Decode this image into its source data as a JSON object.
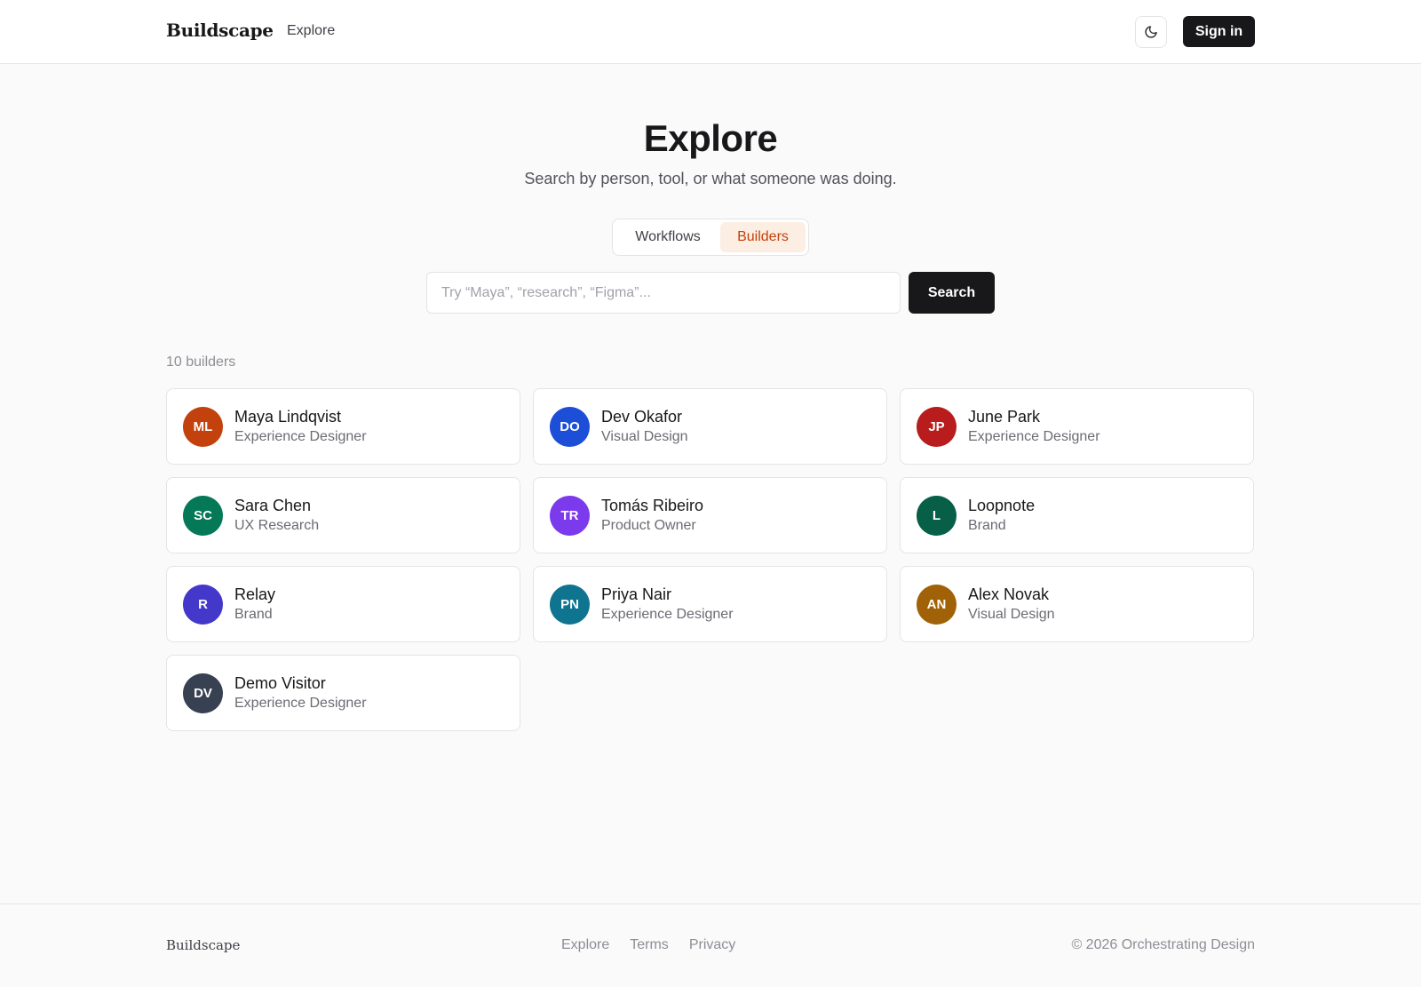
{
  "header": {
    "brand": "Buildscape",
    "nav_explore": "Explore",
    "theme_icon": "moon-icon",
    "signin_label": "Sign in"
  },
  "hero": {
    "title": "Explore",
    "subtitle": "Search by person, tool, or what someone was doing."
  },
  "toggle": {
    "options": [
      {
        "label": "Workflows",
        "selected": false
      },
      {
        "label": "Builders",
        "selected": true
      }
    ]
  },
  "search": {
    "value": "",
    "placeholder": "Try “Maya”, “research”, “Figma”...",
    "button_label": "Search"
  },
  "results": {
    "count_label": "10 builders",
    "builders": [
      {
        "initials": "ML",
        "name": "Maya Lindqvist",
        "role": "Experience Designer",
        "color": "#c2410c"
      },
      {
        "initials": "DO",
        "name": "Dev Okafor",
        "role": "Visual Design",
        "color": "#1d4ed8"
      },
      {
        "initials": "JP",
        "name": "June Park",
        "role": "Experience Designer",
        "color": "#b91c1c"
      },
      {
        "initials": "SC",
        "name": "Sara Chen",
        "role": "UX Research",
        "color": "#047857"
      },
      {
        "initials": "TR",
        "name": "Tomás Ribeiro",
        "role": "Product Owner",
        "color": "#7c3aed"
      },
      {
        "initials": "L",
        "name": "Loopnote",
        "role": "Brand",
        "color": "#065f46"
      },
      {
        "initials": "R",
        "name": "Relay",
        "role": "Brand",
        "color": "#4338ca"
      },
      {
        "initials": "PN",
        "name": "Priya Nair",
        "role": "Experience Designer",
        "color": "#0e7490"
      },
      {
        "initials": "AN",
        "name": "Alex Novak",
        "role": "Visual Design",
        "color": "#a16207"
      },
      {
        "initials": "DV",
        "name": "Demo Visitor",
        "role": "Experience Designer",
        "color": "#374151"
      }
    ]
  },
  "footer": {
    "brand": "Buildscape",
    "links": [
      "Explore",
      "Terms",
      "Privacy"
    ],
    "copyright": "© 2026 Orchestrating Design"
  }
}
